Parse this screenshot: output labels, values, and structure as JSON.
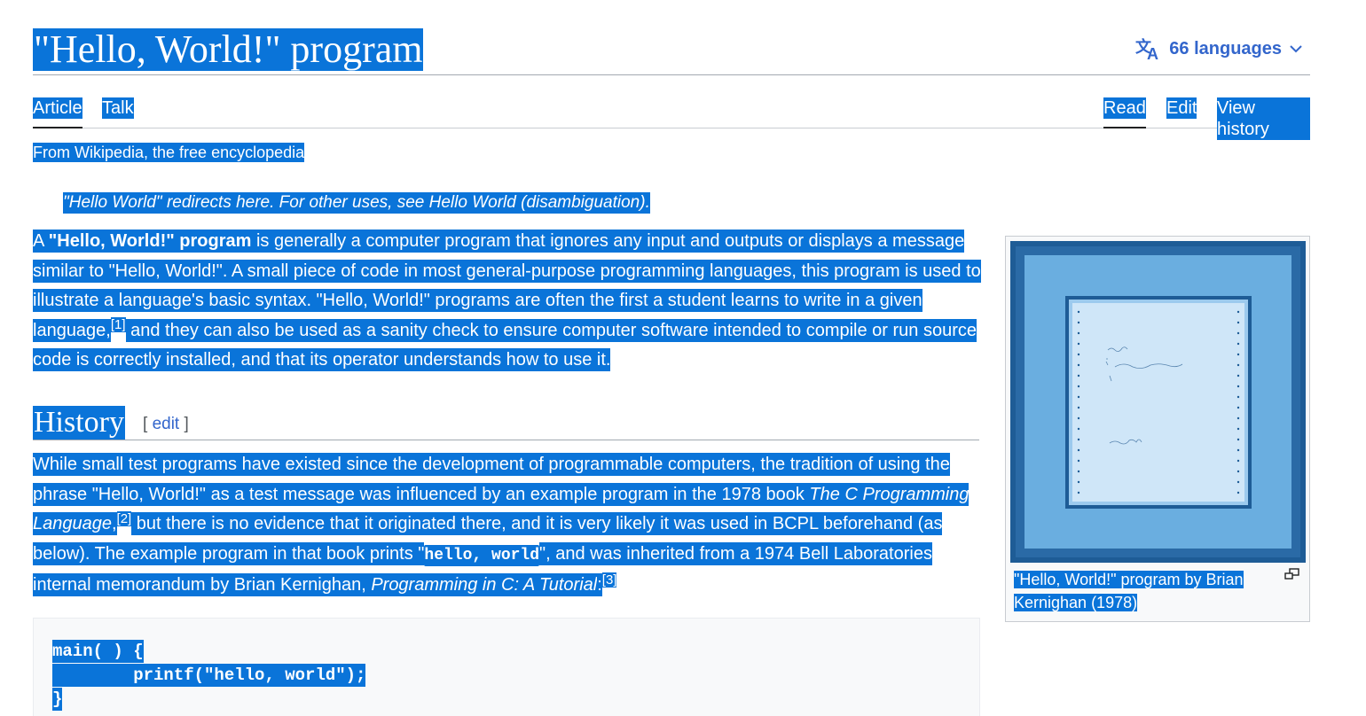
{
  "header": {
    "title": "\"Hello, World!\" program",
    "languages_label": "66 languages"
  },
  "tabs": {
    "left": [
      "Article",
      "Talk"
    ],
    "right": [
      "Read",
      "Edit",
      "View history"
    ]
  },
  "tagline": "From Wikipedia, the free encyclopedia",
  "hatnote": "\"Hello World\" redirects here. For other uses, see Hello World (disambiguation).",
  "intro": {
    "lead_a": "A ",
    "lead_bold": "\"Hello, World!\" program",
    "lead_rest": " is generally a computer program that ignores any input and outputs or displays a message similar to \"Hello, World!\". A small piece of code in most general-purpose programming languages, this program is used to illustrate a language's basic syntax. \"Hello, World!\" programs are often the first a student learns to write in a given language,",
    "ref1": "[1]",
    "tail": " and they can also be used as a sanity check to ensure computer software intended to compile or run source code is correctly installed, and that its operator understands how to use it."
  },
  "history": {
    "heading": "History",
    "edit_open": "[ ",
    "edit_label": "edit",
    "edit_close": " ]",
    "p_a": "While small test programs have existed since the development of programmable computers, the tradition of using the phrase \"Hello, World!\" as a test message was influenced by an example program in the 1978 book ",
    "p_book": "The C Programming Language",
    "p_comma": ",",
    "ref2": "[2]",
    "p_b": " but there is no evidence that it originated there, and it is very likely it was used in BCPL beforehand (as below). The example program in that book prints \"",
    "code_inline": "hello, world",
    "p_c": "\", and was inherited from a 1974 Bell Laboratories internal memorandum by Brian Kernighan, ",
    "p_memo": "Programming in C: A Tutorial",
    "p_colon": ":",
    "ref3": "[3]"
  },
  "code": [
    "main( ) {",
    "        printf(\"hello, world\");",
    "}"
  ],
  "figure": {
    "caption": "\"Hello, World!\" program by Brian Kernighan (1978)",
    "image_icon": "framed-manuscript-image",
    "enlarge_icon": "enlarge-icon"
  },
  "colors": {
    "selection": "#0a74d9",
    "link": "#3366cc"
  }
}
